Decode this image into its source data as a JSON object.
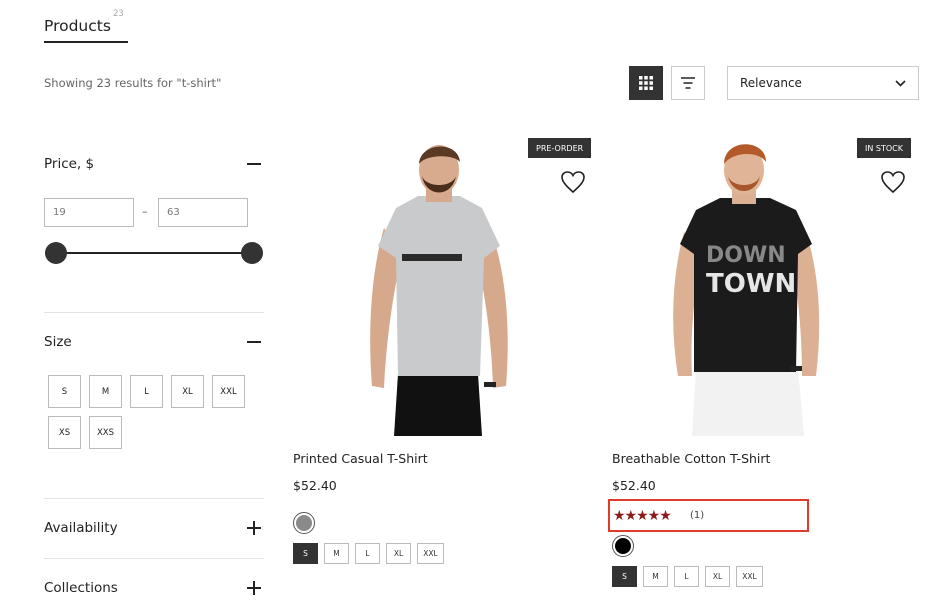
{
  "header": {
    "title": "Products",
    "count": "23",
    "results_text": "Showing 23 results for \"t-shirt\"",
    "sort_value": "Relevance"
  },
  "filters": {
    "price": {
      "label": "Price, $",
      "min": "19",
      "max": "63",
      "dash": "–"
    },
    "size": {
      "label": "Size",
      "options": [
        "S",
        "M",
        "L",
        "XL",
        "XXL",
        "XS",
        "XXS"
      ]
    },
    "availability": {
      "label": "Availability"
    },
    "collections": {
      "label": "Collections"
    }
  },
  "products": [
    {
      "name": "Printed Casual T-Shirt",
      "price": "$52.40",
      "badge": "PRE-ORDER",
      "shirt_color": "#c9cacc",
      "swatch_color": "#8a8a8a",
      "sizes": [
        "S",
        "M",
        "L",
        "XL",
        "XXL"
      ],
      "selected_size": "S"
    },
    {
      "name": "Breathable Cotton T-Shirt",
      "price": "$52.40",
      "badge": "IN STOCK",
      "shirt_color": "#1b1b1b",
      "swatch_color": "#000000",
      "rating_stars": "★★★★★",
      "rating_count": "(1)",
      "print_text_1": "DOWN",
      "print_text_2": "TOWN",
      "sizes": [
        "S",
        "M",
        "L",
        "XL",
        "XXL"
      ],
      "selected_size": "S"
    }
  ],
  "colors": {
    "accent_dark": "#333333",
    "highlight": "#e03a2a",
    "star": "#8b1c1c"
  },
  "icons": {
    "grid_view": "grid-view-icon",
    "list_view": "list-view-icon",
    "chevron": "chevron-down-icon",
    "wishlist": "heart-icon"
  }
}
